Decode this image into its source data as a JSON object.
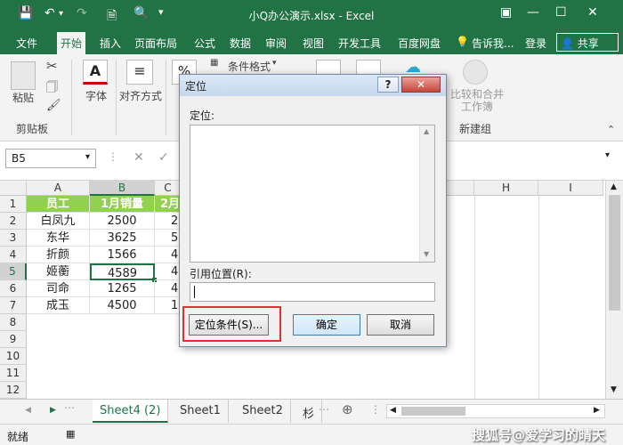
{
  "window": {
    "title": "小Q办公演示.xlsx - Excel"
  },
  "menu": {
    "items": [
      "文件",
      "开始",
      "插入",
      "页面布局",
      "公式",
      "数据",
      "审阅",
      "视图",
      "开发工具",
      "百度网盘"
    ],
    "tell_me": "告诉我...",
    "login": "登录",
    "share": "共享"
  },
  "ribbon": {
    "paste": "粘贴",
    "clipboard_group": "剪贴板",
    "font": "字体",
    "align": "对齐方式",
    "number_sym": "%",
    "cond_format": "条件格式",
    "merge": "比较和合并\n工作簿",
    "new_group": "新建组"
  },
  "formula_bar": {
    "name_box": "B5"
  },
  "grid": {
    "columns": [
      "A",
      "B",
      "C",
      "H",
      "I"
    ],
    "rows": [
      "1",
      "2",
      "3",
      "4",
      "5",
      "6",
      "7",
      "8",
      "9",
      "10",
      "11",
      "12"
    ],
    "col_a": [
      "员工",
      "白凤九",
      "东华",
      "折颜",
      "姬蘅",
      "司命",
      "成玉"
    ],
    "col_b": [
      "1月销量",
      "2500",
      "3625",
      "1566",
      "4589",
      "1265",
      "4500"
    ],
    "col_c": [
      "2月",
      "2",
      "5",
      "4",
      "4",
      "4",
      "1"
    ]
  },
  "sheets": {
    "tabs": [
      "Sheet4 (2)",
      "Sheet1",
      "Sheet2",
      "杉"
    ]
  },
  "status": {
    "ready": "就绪",
    "watermark": "搜狐号@爱学习的晴天"
  },
  "dialog": {
    "title": "定位",
    "help": "?",
    "list_label": "定位:",
    "ref_label": "引用位置(R):",
    "ref_value": "",
    "special_button": "定位条件(S)...",
    "ok_button": "确定",
    "cancel_button": "取消"
  }
}
